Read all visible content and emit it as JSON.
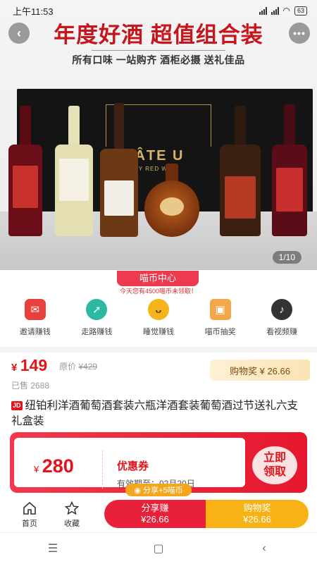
{
  "status_bar": {
    "time": "上午11:53",
    "battery": "63"
  },
  "hero": {
    "title": "年度好酒 超值组合装",
    "subtitle": "所有口味 一站购齐 酒柜必摄 送礼佳品",
    "box_brand": "HÂTE U",
    "box_brand_sub": "ORY RED WI",
    "counter": "1/10"
  },
  "coin_center": {
    "title": "喵币中心",
    "note": "今天您有4500喵币未领取！",
    "items": [
      {
        "label": "邀请赚钱",
        "icon": "red-envelope-icon",
        "color": "#e8403d"
      },
      {
        "label": "走路赚钱",
        "icon": "running-icon",
        "color": "#2bb9a4"
      },
      {
        "label": "睡觉赚钱",
        "icon": "cat-face-icon",
        "color": "#f4b41a"
      },
      {
        "label": "喵币抽奖",
        "icon": "gift-box-icon",
        "color": "#f3a64a"
      },
      {
        "label": "看视频赚",
        "icon": "video-app-icon",
        "color": "#333333"
      }
    ]
  },
  "price": {
    "symbol": "¥",
    "value": "149",
    "original_label": "原价",
    "original_value": "¥429",
    "sold": "已售 2688",
    "reward_tag": "购物奖 ¥ 26.66"
  },
  "product": {
    "badge": "JD",
    "title": "纽铂利洋酒葡萄酒套装六瓶洋酒套装葡萄酒过节送礼六支礼盒装"
  },
  "coupon": {
    "symbol": "¥",
    "amount": "280",
    "title": "优惠券",
    "valid": "有效期至：02月20日",
    "button_line1": "立即",
    "button_line2": "领取"
  },
  "share_pill": "分享+5喵币",
  "bottom_bar": {
    "home": "首页",
    "favorite": "收藏",
    "share_label": "分享赚",
    "share_value": "¥26.66",
    "buy_label": "购物奖",
    "buy_value": "¥26.66"
  },
  "system_nav": {
    "menu": "☰",
    "home": "▢",
    "back": "‹"
  }
}
